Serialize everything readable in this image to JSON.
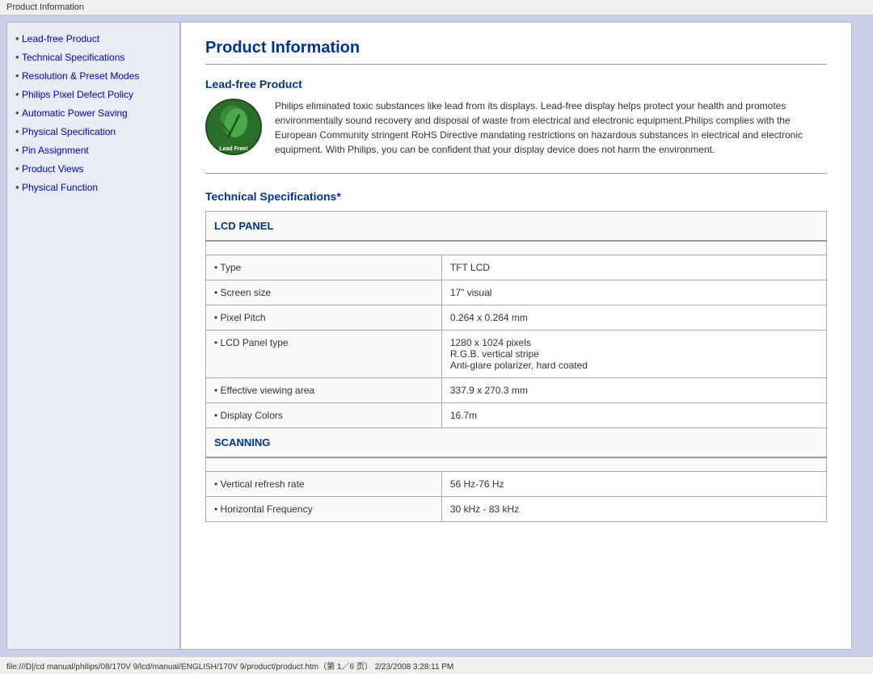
{
  "title_bar": "Product Information",
  "status_bar": "file:///D|/cd manual/philips/08/170V 9/lcd/manual/ENGLISH/170V 9/product/product.htm（第 1／6 页） 2/23/2008 3:28:11 PM",
  "page_title": "Product Information",
  "sidebar": {
    "items": [
      {
        "label": "Lead-free Product",
        "href": "#lead-free"
      },
      {
        "label": "Technical Specifications",
        "href": "#tech-specs"
      },
      {
        "label": "Resolution & Preset Modes",
        "href": "#resolution"
      },
      {
        "label": "Philips Pixel Defect Policy",
        "href": "#pixel-defect"
      },
      {
        "label": "Automatic Power Saving",
        "href": "#power-saving"
      },
      {
        "label": "Physical Specification",
        "href": "#physical-spec"
      },
      {
        "label": "Pin Assignment",
        "href": "#pin-assignment"
      },
      {
        "label": "Product Views",
        "href": "#product-views"
      },
      {
        "label": "Physical Function",
        "href": "#physical-function"
      }
    ]
  },
  "sections": {
    "lead_free": {
      "title": "Lead-free Product",
      "text": "Philips eliminated toxic substances like lead from its displays. Lead-free display helps protect your health and promotes environmentally sound recovery and disposal of waste from electrical and electronic equipment.Philips complies with the European Community stringent RoHS Directive mandating restrictions on hazardous substances in electrical and electronic equipment. With Philips, you can be confident that your display device does not harm the environment."
    },
    "tech_specs": {
      "title": "Technical Specifications*",
      "lcd_panel_header": "LCD PANEL",
      "scanning_header": "SCANNING",
      "rows": [
        {
          "label": "• Type",
          "value": "TFT LCD",
          "section": "lcd"
        },
        {
          "label": "• Screen size",
          "value": "17\" visual",
          "section": "lcd"
        },
        {
          "label": "• Pixel Pitch",
          "value": "0.264 x 0.264 mm",
          "section": "lcd"
        },
        {
          "label": "• LCD Panel type",
          "value": "1280 x 1024 pixels\nR.G.B. vertical stripe\nAnti-glare polarizer, hard coated",
          "section": "lcd"
        },
        {
          "label": "• Effective viewing area",
          "value": "337.9 x 270.3 mm",
          "section": "lcd"
        },
        {
          "label": "• Display Colors",
          "value": "16.7m",
          "section": "lcd"
        },
        {
          "label": "• Vertical refresh rate",
          "value": "56 Hz-76 Hz",
          "section": "scanning"
        },
        {
          "label": "• Horizontal Frequency",
          "value": "30 kHz - 83 kHz",
          "section": "scanning"
        }
      ]
    }
  }
}
